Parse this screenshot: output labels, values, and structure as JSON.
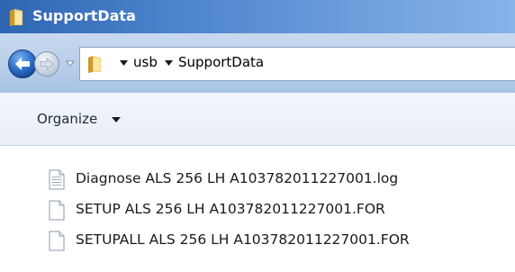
{
  "window": {
    "title": "SupportData"
  },
  "navigation": {
    "breadcrumbs": [
      "usb",
      "SupportData"
    ]
  },
  "commandbar": {
    "organize_label": "Organize"
  },
  "files": [
    {
      "name": "Diagnose ALS 256 LH A103782011227001.log",
      "icon": "text-document-icon"
    },
    {
      "name": "SETUP ALS 256 LH A103782011227001.FOR",
      "icon": "blank-document-icon"
    },
    {
      "name": "SETUPALL ALS 256 LH A103782011227001.FOR",
      "icon": "blank-document-icon"
    }
  ]
}
